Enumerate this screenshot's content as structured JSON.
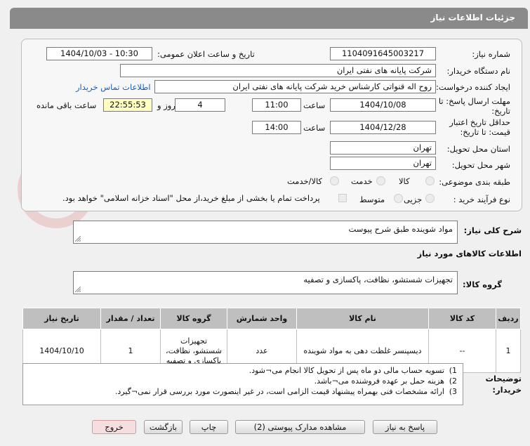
{
  "header": {
    "title": "جزئیات اطلاعات نیاز"
  },
  "info": {
    "need_number_label": "شماره نیاز:",
    "need_number": "1104091645003217",
    "announce_label": "تاریخ و ساعت اعلان عمومی:",
    "announce_value": "1404/10/03 - 10:30",
    "buyer_label": "نام دستگاه خریدار:",
    "buyer_value": "شرکت پایانه های نفتی ایران",
    "creator_label": "ایجاد کننده درخواست:",
    "creator_value": "روح اله قنواتی کارشناس خرید شرکت پایانه های نفتی ایران",
    "contact_link": "اطلاعات تماس خریدار",
    "deadline_label_1": "مهلت ارسال پاسخ: تا",
    "deadline_label_2": "تاریخ:",
    "deadline_date": "1404/10/08",
    "time_label": "ساعت",
    "deadline_time": "11:00",
    "days_value": "4",
    "days_label": "روز و",
    "remaining_time": "22:55:53",
    "remaining_label": "ساعت باقی مانده",
    "validity_label_1": "حداقل تاریخ اعتبار",
    "validity_label_2": "قیمت: تا تاریخ:",
    "validity_date": "1404/12/28",
    "validity_time": "14:00",
    "province_label": "استان محل تحویل:",
    "province_value": "تهران",
    "city_label": "شهر محل تحویل:",
    "city_value": "تهران",
    "category_label": "طبقه بندی موضوعی:",
    "category_options": [
      "کالا",
      "خدمت",
      "کالا/خدمت"
    ],
    "process_label": "نوع فرآیند خرید :",
    "process_options": [
      "جزیی",
      "متوسط"
    ],
    "payment_note": "پرداخت تمام یا بخشی از مبلغ خرید،از محل \"اسناد خزانه اسلامی\" خواهد بود."
  },
  "description": {
    "label": "شرح کلی نیاز:",
    "value": "مواد شوینده طبق شرح پیوست"
  },
  "goods": {
    "section_title": "اطلاعات کالاهای مورد نیاز",
    "group_label": "گروه کالا:",
    "group_value": "تجهیزات شستشو، نظافت، پاکسازی و تصفیه"
  },
  "table": {
    "headers": [
      "ردیف",
      "کد کالا",
      "نام کالا",
      "واحد شمارش",
      "گروه کالا",
      "تعداد / مقدار",
      "تاریخ نیاز"
    ],
    "rows": [
      {
        "index": "1",
        "code": "--",
        "name": "دیسپنسر غلظت دهی به مواد شوینده",
        "unit": "عدد",
        "group_1": "تجهیزات",
        "group_2": "شستشو، نظافت،",
        "group_3": "پاکسازی و تصفیه",
        "qty": "1",
        "date": "1404/10/10"
      }
    ]
  },
  "notes": {
    "label_1": "توضیحات",
    "label_2": "خریدار:",
    "lines": [
      {
        "n": "1)",
        "text": "تسویه حساب مالی دو ماه پس از تحویل کالا انجام می¬شود."
      },
      {
        "n": "2)",
        "text": "هزینه حمل بر عهده فروشنده می¬باشد."
      },
      {
        "n": "3)",
        "text": "ارائه مشخصات فنی بهمراه پیشنهاد قیمت الزامی است، در غیر اینصورت مورد بررسی قرار نمی¬گیرد."
      }
    ]
  },
  "buttons": {
    "reply": "پاسخ به نیاز",
    "docs": "مشاهده مدارک پیوستی (2)",
    "print": "چاپ",
    "back": "بازگشت",
    "exit": "خروج"
  },
  "colors": {
    "title_bar": "#8a8a8a",
    "table_header": "#bfbfbf",
    "link": "#1a5fb4",
    "highlight": "#ffffc2"
  }
}
